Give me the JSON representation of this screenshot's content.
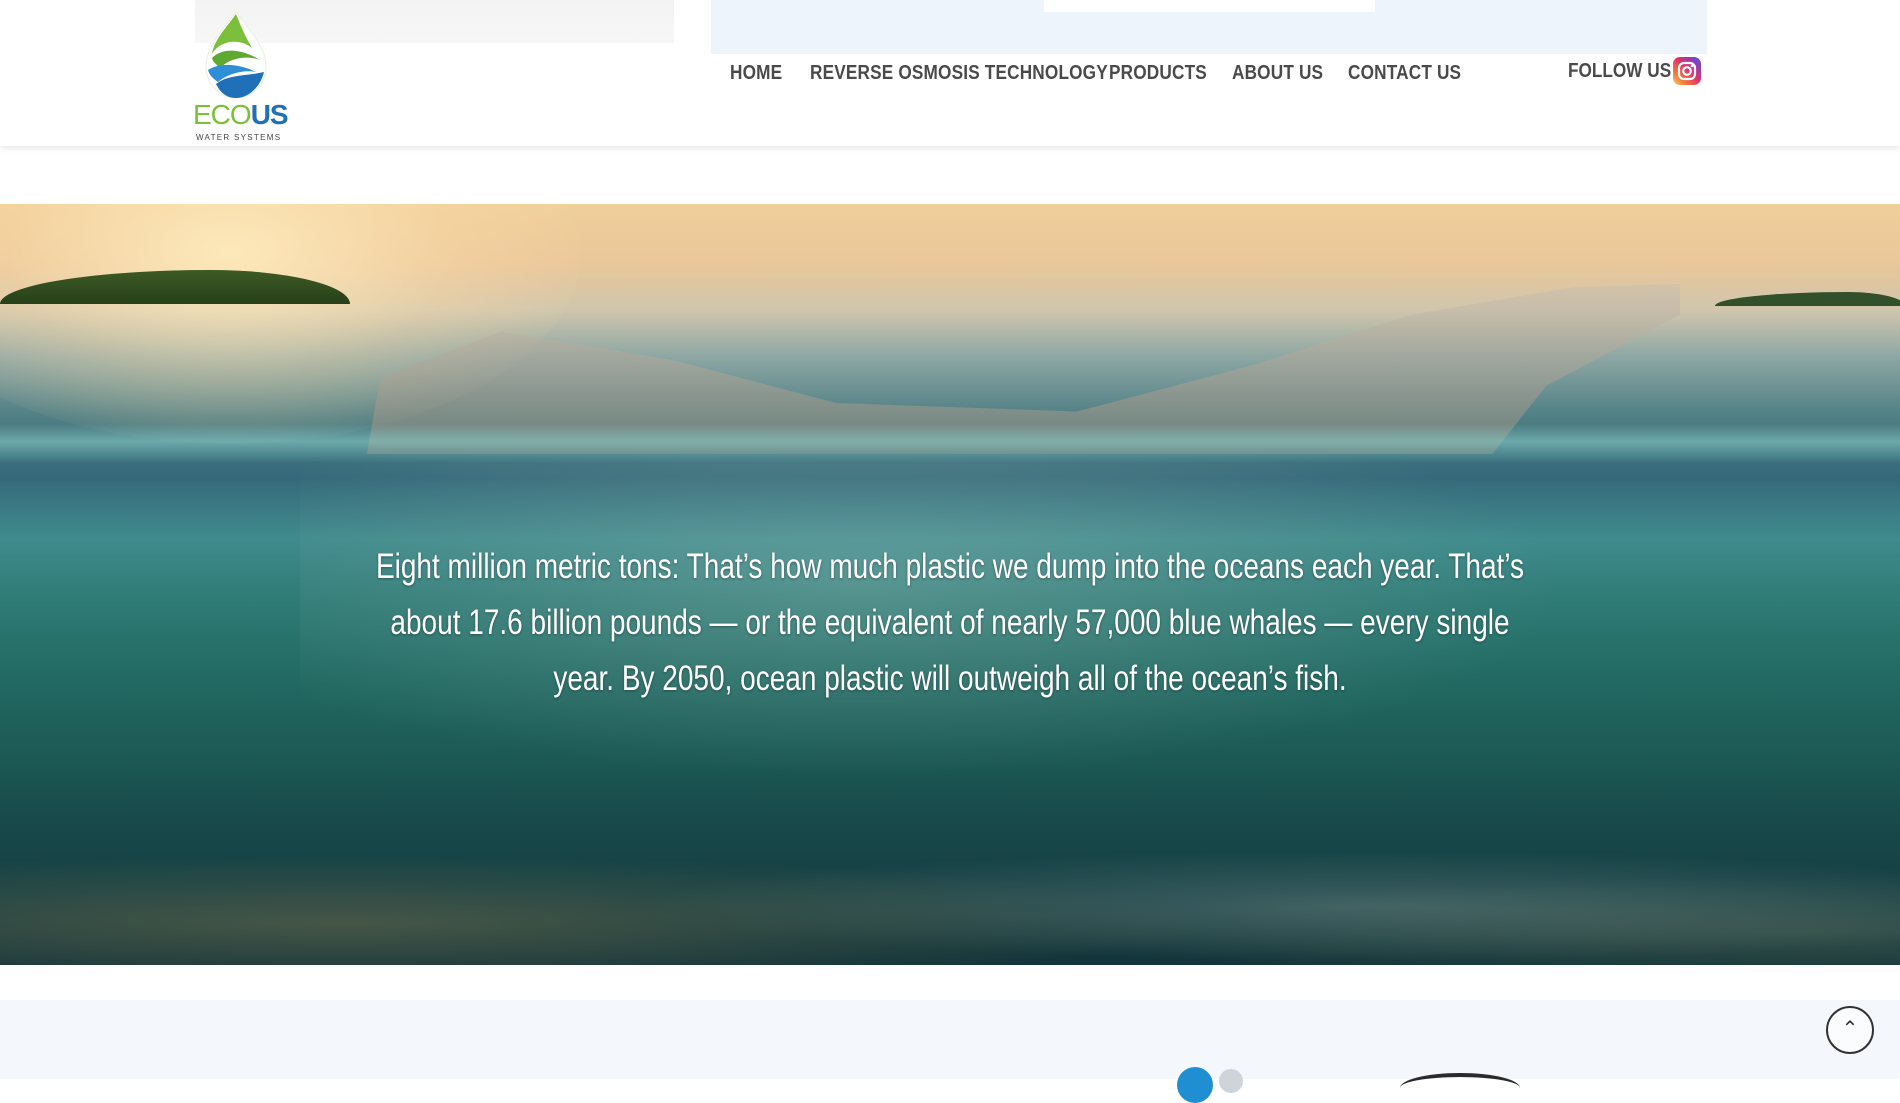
{
  "brand": {
    "logo_word_eco": "ECO",
    "logo_word_us": "US",
    "logo_subtitle": "WATER SYSTEMS",
    "colors": {
      "green": "#7bbf3a",
      "blue": "#1f6fb9"
    }
  },
  "nav": {
    "items": [
      {
        "label": "HOME"
      },
      {
        "label": "REVERSE OSMOSIS TECHNOLOGY"
      },
      {
        "label": "PRODUCTS"
      },
      {
        "label": "ABOUT US"
      },
      {
        "label": "CONTACT US"
      }
    ]
  },
  "social": {
    "follow_label": "FOLLOW US",
    "icon": "instagram-icon"
  },
  "hero": {
    "text": "Eight million metric tons: That’s how much plastic we dump into the oceans each year. That’s about 17.6 billion pounds — or the equivalent of nearly 57,000 blue whales — every single year. By 2050, ocean plastic will outweigh all of the ocean’s fish."
  },
  "back_to_top": {
    "icon": "chevron-up-icon",
    "glyph": "⌃"
  }
}
